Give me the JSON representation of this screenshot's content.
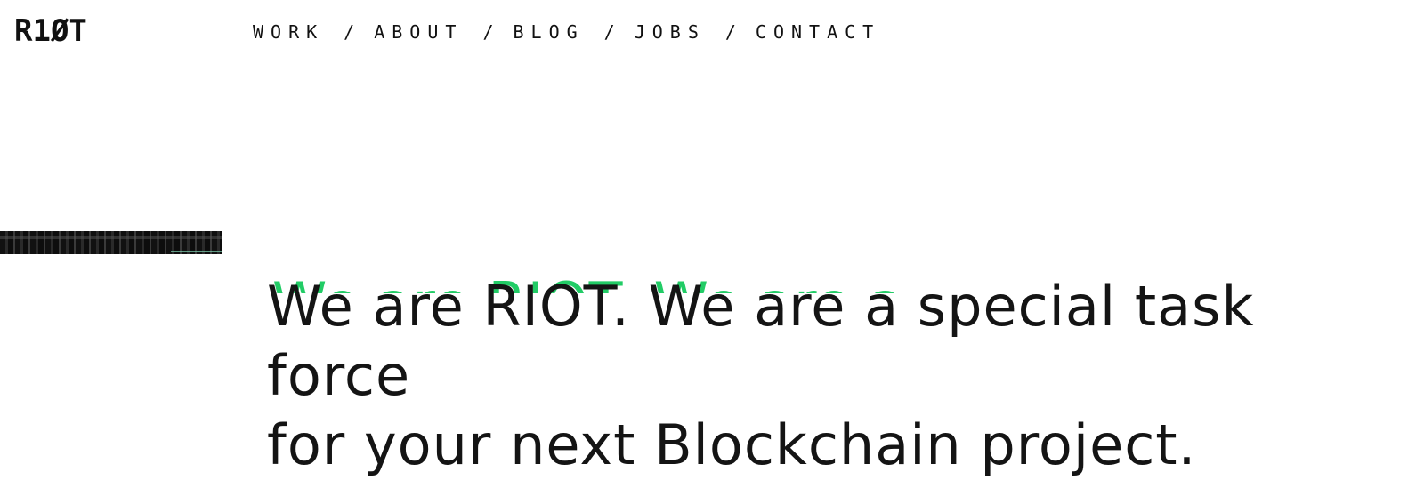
{
  "header": {
    "logo": "R1ØT",
    "nav": [
      {
        "label": "WORK"
      },
      {
        "label": "ABOUT"
      },
      {
        "label": "BLOG"
      },
      {
        "label": "JOBS"
      },
      {
        "label": "CONTACT"
      }
    ],
    "separator": "/"
  },
  "hero": {
    "headline_line1": "We are RIOT. We are a special task force",
    "headline_line2": "for your next Blockchain project.",
    "ghost_text": "We are RIOT. We are a sp"
  },
  "colors": {
    "text": "#141414",
    "accent": "#22cc66",
    "background": "#ffffff"
  }
}
